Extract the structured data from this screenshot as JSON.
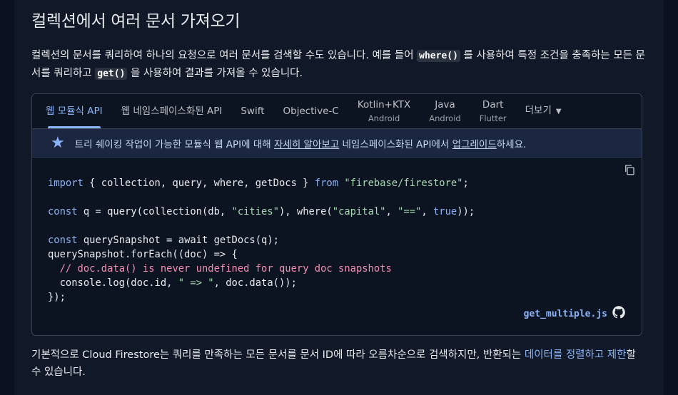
{
  "heading": "컬렉션에서 여러 문서 가져오기",
  "intro": {
    "part1": "컬렉션의 문서를 쿼리하여 하나의 요청으로 여러 문서를 검색할 수도 있습니다. 예를 들어 ",
    "code1": "where()",
    "part2": " 를 사용하여 특정 조건을 충족하는 모든 문서를 쿼리하고 ",
    "code2": "get()",
    "part3": " 을 사용하여 결과를 가져올 수 있습니다."
  },
  "tabs": [
    {
      "label": "웹 모듈식 API",
      "sub": ""
    },
    {
      "label": "웹 네임스페이스화된 API",
      "sub": ""
    },
    {
      "label": "Swift",
      "sub": ""
    },
    {
      "label": "Objective-C",
      "sub": ""
    },
    {
      "label": "Kotlin+KTX",
      "sub": "Android"
    },
    {
      "label": "Java",
      "sub": "Android"
    },
    {
      "label": "Dart",
      "sub": "Flutter"
    },
    {
      "label": "더보기",
      "sub": ""
    }
  ],
  "banner": {
    "icon": "star-icon",
    "text1": "트리 쉐이킹 작업이 가능한 모듈식 웹 API에 대해 ",
    "link1": "자세히 알아보고",
    "text2": " 네임스페이스화된 API에서 ",
    "link2": "업그레이드",
    "text3": "하세요."
  },
  "code": {
    "l1_import": "import",
    "l1_names": " { collection, query, where, getDocs } ",
    "l1_from": "from",
    "l1_sp": " ",
    "l1_str": "\"firebase/firestore\"",
    "l1_end": ";",
    "l3_const": "const",
    "l3_a": " q = query(collection(db, ",
    "l3_s1": "\"cities\"",
    "l3_b": "), where(",
    "l3_s2": "\"capital\"",
    "l3_c": ", ",
    "l3_s3": "\"==\"",
    "l3_d": ", ",
    "l3_true": "true",
    "l3_e": "));",
    "l5_const": "const",
    "l5_a": " querySnapshot = await getDocs(q);",
    "l6": "querySnapshot.forEach((doc) => {",
    "l7_indent": "  ",
    "l7_comment": "// doc.data() is never undefined for query doc snapshots",
    "l8_a": "  console.log(doc.id, ",
    "l8_s": "\" => \"",
    "l8_b": ", doc.data());",
    "l9": "});"
  },
  "file_link": "get_multiple.js",
  "outro": {
    "part1": "기본적으로 Cloud Firestore는 쿼리를 만족하는 모든 문서를 문서 ID에 따라 오름차순으로 검색하지만, 반환되는 ",
    "link": "데이터를 정렬하고 제한",
    "part2": "할 수 있습니다."
  }
}
